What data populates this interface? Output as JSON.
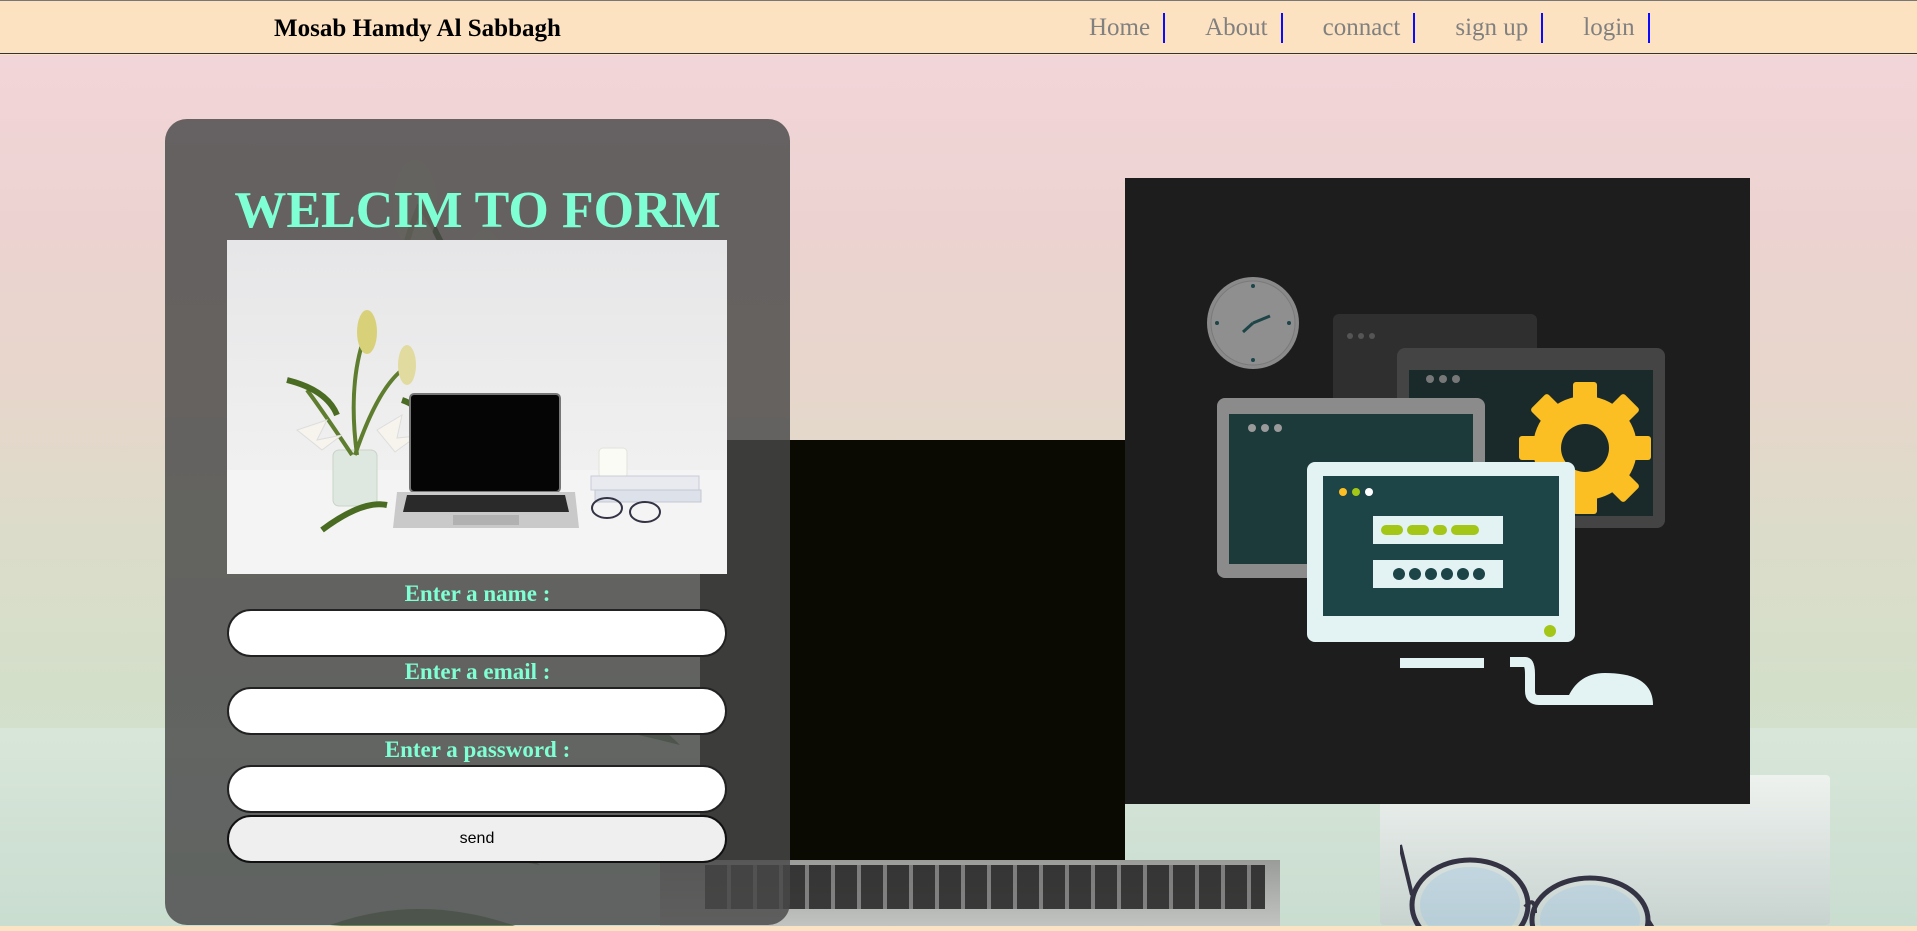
{
  "header": {
    "brand": "Mosab Hamdy Al Sabbagh",
    "nav": [
      "Home",
      "About",
      "connact",
      "sign up",
      "login"
    ]
  },
  "form": {
    "title": "WELCIM TO FORM",
    "image_alt": "desk with laptop and lilies",
    "name_label": "Enter a name :",
    "email_label": "Enter a email :",
    "password_label": "Enter a password :",
    "name_value": "",
    "email_value": "",
    "password_value": "",
    "send_label": "send"
  },
  "illustration": {
    "description_icons": [
      "clock-icon",
      "browser-window-icon",
      "gear-icon",
      "monitor-login-icon",
      "mouse-icon"
    ],
    "colors": {
      "background": "#1d1d1d",
      "gear": "#fbbf24",
      "screen": "#1d4548",
      "accent_green": "#a3c617"
    }
  },
  "colors": {
    "header_bg": "#fde2c1",
    "title_color": "#7fffd4",
    "nav_separator": "#0a0aff"
  }
}
